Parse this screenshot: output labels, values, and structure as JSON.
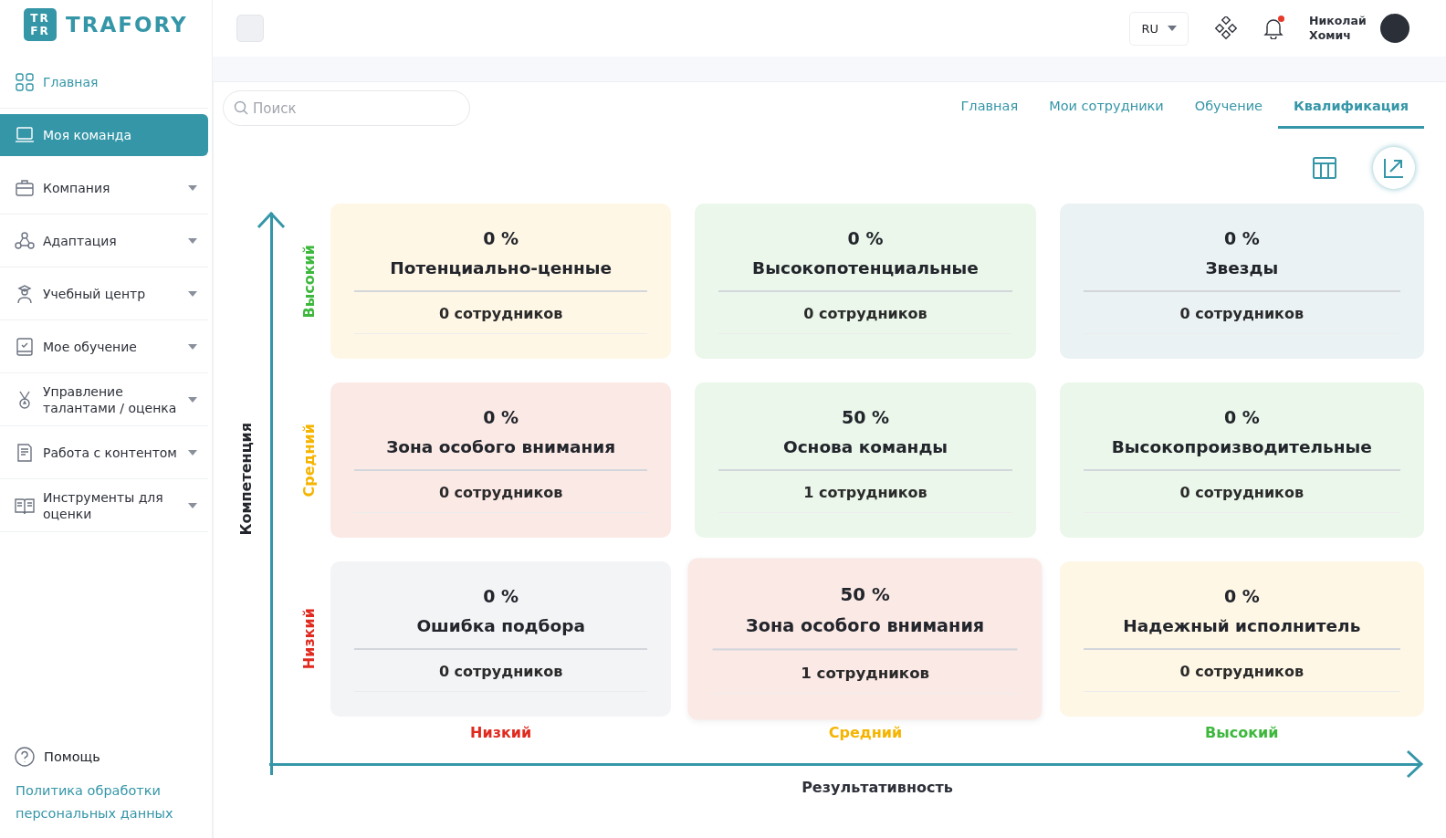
{
  "logo": {
    "mark_top": "TR",
    "mark_bottom": "FR",
    "text": "TRAFORY"
  },
  "sidebar": {
    "items": [
      {
        "label": "Главная",
        "selected": false,
        "accent": true,
        "expandable": false
      },
      {
        "label": "Моя команда",
        "selected": true,
        "accent": false,
        "expandable": false
      },
      {
        "label": "Компания",
        "selected": false,
        "accent": false,
        "expandable": true
      },
      {
        "label": "Адаптация",
        "selected": false,
        "accent": false,
        "expandable": true
      },
      {
        "label": "Учебный центр",
        "selected": false,
        "accent": false,
        "expandable": true
      },
      {
        "label": "Мое обучение",
        "selected": false,
        "accent": false,
        "expandable": true
      },
      {
        "label": "Управление талантами / оценка",
        "selected": false,
        "accent": false,
        "expandable": true
      },
      {
        "label": "Работа с контентом",
        "selected": false,
        "accent": false,
        "expandable": true
      },
      {
        "label": "Инструменты для оценки",
        "selected": false,
        "accent": false,
        "expandable": true
      }
    ],
    "help": "Помощь",
    "policy_link": "Политика обработки персональных данных"
  },
  "header": {
    "language": "RU",
    "notification": true,
    "user_name": "Николай Хомич"
  },
  "search": {
    "placeholder": "Поиск"
  },
  "tabs": [
    {
      "label": "Главная",
      "selected": false
    },
    {
      "label": "Мои сотрудники",
      "selected": false
    },
    {
      "label": "Обучение",
      "selected": false
    },
    {
      "label": "Квалификация",
      "selected": true
    }
  ],
  "view_buttons": [
    {
      "kind": "table",
      "selected": false
    },
    {
      "kind": "chart",
      "selected": true
    }
  ],
  "matrix": {
    "y_title": "Компетенция",
    "x_title": "Результативность",
    "row_labels": [
      {
        "text": "Высокий",
        "color": "#3db83d"
      },
      {
        "text": "Средний",
        "color": "#f5b400"
      },
      {
        "text": "Низкий",
        "color": "#e02a1f"
      }
    ],
    "column_labels": [
      {
        "text": "Низкий",
        "color": "#e02a1f"
      },
      {
        "text": "Средний",
        "color": "#f5b400"
      },
      {
        "text": "Высокий",
        "color": "#3db83d"
      }
    ],
    "cards": [
      {
        "percent": "0 %",
        "title": "Потенциально-ценные",
        "count": "0 сотрудников",
        "color": "#fff7e6",
        "highlighted": false
      },
      {
        "percent": "0 %",
        "title": "Высокопотенциальные",
        "count": "0 сотрудников",
        "color": "#eaf7ea",
        "highlighted": false
      },
      {
        "percent": "0 %",
        "title": "Звезды",
        "count": "0 сотрудников",
        "color": "#eaf2f3",
        "highlighted": false
      },
      {
        "percent": "0 %",
        "title": "Зона особого внимания",
        "count": "0 сотрудников",
        "color": "#fbe9e6",
        "highlighted": false
      },
      {
        "percent": "50 %",
        "title": "Основа команды",
        "count": "1 сотрудников",
        "color": "#eaf7ea",
        "highlighted": false
      },
      {
        "percent": "0 %",
        "title": "Высокопроизводительные",
        "count": "0 сотрудников",
        "color": "#eaf7ea",
        "highlighted": false
      },
      {
        "percent": "0 %",
        "title": "Ошибка подбора",
        "count": "0 сотрудников",
        "color": "#f3f4f6",
        "highlighted": false
      },
      {
        "percent": "50 %",
        "title": "Зона особого внимания",
        "count": "1 сотрудников",
        "color": "#fbe9e6",
        "highlighted": true
      },
      {
        "percent": "0 %",
        "title": "Надежный исполнитель",
        "count": "0 сотрудников",
        "color": "#fff7e6",
        "highlighted": false
      }
    ]
  }
}
